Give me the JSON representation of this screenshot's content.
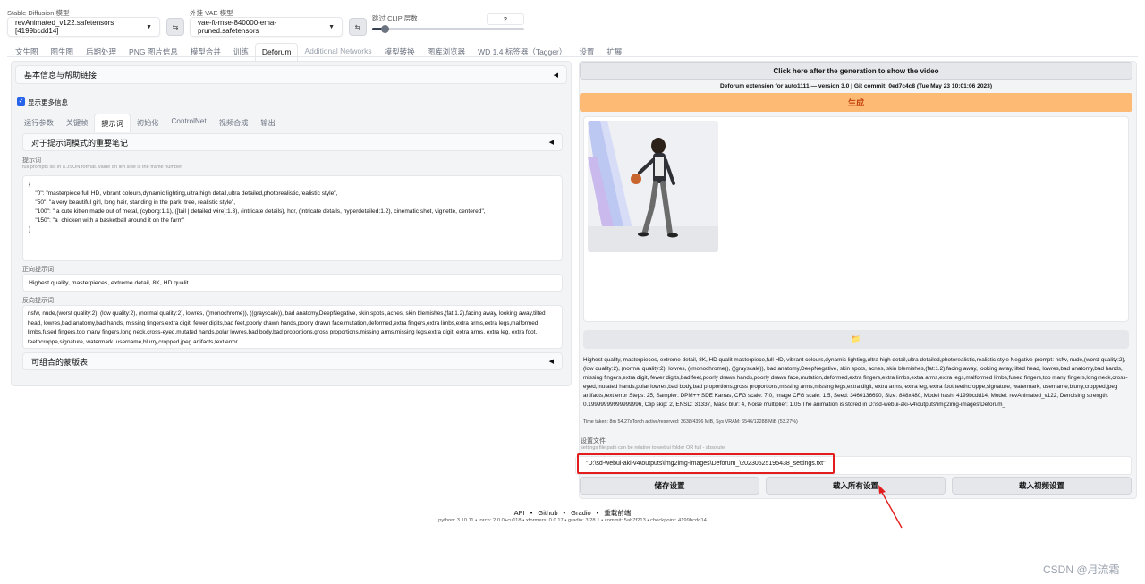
{
  "top": {
    "sd_model_label": "Stable Diffusion 模型",
    "sd_model_value": "revAnimated_v122.safetensors [4199bcdd14]",
    "vae_label": "外挂 VAE 模型",
    "vae_value": "vae-ft-mse-840000-ema-pruned.safetensors",
    "clip_label": "跳过 CLIP 层数",
    "clip_value": "2",
    "clip_fraction": 0.08
  },
  "tabs": [
    {
      "label": "文生图"
    },
    {
      "label": "图生图"
    },
    {
      "label": "后期处理"
    },
    {
      "label": "PNG 图片信息"
    },
    {
      "label": "模型合并"
    },
    {
      "label": "训练"
    },
    {
      "label": "Deforum"
    },
    {
      "label": "Additional Networks"
    },
    {
      "label": "模型转换"
    },
    {
      "label": "图库浏览器"
    },
    {
      "label": "WD 1.4 标签器（Tagger）"
    },
    {
      "label": "设置"
    },
    {
      "label": "扩展"
    }
  ],
  "left": {
    "info_accordion": "基本信息与帮助链接",
    "show_more_label": "显示更多信息",
    "subtabs": [
      "运行参数",
      "关键帧",
      "提示词",
      "初始化",
      "ControlNet",
      "视频合成",
      "输出"
    ],
    "notes_accordion": "对于提示词模式的重要笔记",
    "prompts_label": "提示词",
    "prompts_hint": "full prompts list in a JSON format.  value on left side is the frame number",
    "prompts_lines": [
      "{",
      "    \"0\": \"masterpiece,full HD, vibrant colours,dynamic lighting,ultra high detail,ultra detailed,photorealistic,realistic style\",",
      "    \"50\": \"a very beautiful girl, long hair, standing in the park, tree, realistic style\",",
      "    \"100\": \" a cute kitten made out of metal, (cyborg:1.1), ([tail | detailed wire]:1.3), (intricate details), hdr, (intricate details, hyperdetailed:1.2), cinematic shot, vignette, centered\",",
      "    \"150\": \"a  chicken with a basketball around it on the farm\"",
      "}"
    ],
    "positive_label": "正向提示词",
    "positive_value": "Highest quality, masterpieces, extreme detail, 8K, HD qualit",
    "negative_label": "反向提示词",
    "negative_value": "nsfw, nude,(worst quality:2), (low quality:2), (normal quality:2), lowres, ((monochrome)), ((grayscale)), bad anatomy,DeepNegative, skin spots, acnes, skin blemishes,(fat:1.2),facing away, looking away,tilted head, lowres,bad anatomy,bad hands, missing fingers,extra digit, fewer digits,bad feet,poorly drawn hands,poorly drawn face,mutation,deformed,extra fingers,extra limbs,extra arms,extra legs,malformed limbs,fused fingers,too many fingers,long neck,cross-eyed,mutated hands,polar lowres,bad body,bad proportions,gross proportions,missing arms,missing legs,extra digit, extra arms, extra leg, extra foot, teethcroppe,signature, watermark, username,blurry,cropped,jpeg artifacts,text,error",
    "mask_accordion": "可组合的蒙版表"
  },
  "right": {
    "show_video_button": "Click here after the generation to show the video",
    "version_text": "Deforum extension for auto1111 — version 3.0 | Git commit: 0ed7c4c8 (Tue May 23 10:01:06 2023)",
    "generate_button": "生成",
    "folder_icon": "📁",
    "info_text": "Highest quality, masterpieces, extreme detail, 8K, HD qualit masterpiece,full HD, vibrant colours,dynamic lighting,ultra high detail,ultra detailed,photorealistic,realistic style Negative prompt: nsfw, nude,(worst quality:2), (low quality:2), (normal quality:2), lowres, ((monochrome)), ((grayscale)), bad anatomy,DeepNegative, skin spots, acnes, skin blemishes,(fat:1.2),facing away, looking away,tilted head, lowres,bad anatomy,bad hands, missing fingers,extra digit, fewer digits,bad feet,poorly drawn hands,poorly drawn face,mutation,deformed,extra fingers,extra limbs,extra arms,extra legs,malformed limbs,fused fingers,too many fingers,long neck,cross-eyed,mutated hands,polar lowres,bad body,bad proportions,gross proportions,missing arms,missing legs,extra digit, extra arms, extra leg, extra foot,teethcroppe,signature, watermark, username,blurry,cropped,jpeg artifacts,text,error Steps: 25, Sampler: DPM++ SDE Karras, CFG scale: 7.0, Image CFG scale: 1.5, Seed: 3460136690, Size: 848x480, Model hash: 4199bcdd14, Model: revAnimated_v122, Denoising strength: 0.19999999999999996, Clip skip: 2, ENSD: 31337, Mask blur: 4, Noise multiplier: 1.05 The animation is stored in D:\\sd-webui-aki-v4\\outputs\\img2img-images\\Deforum_",
    "time_text": "Time taken: 8m 54.27sTorch active/reserved: 3638/4396 MiB, Sys VRAM: 6546/12288 MiB (53.27%)",
    "settings_label": "设置文件",
    "settings_hint": "settings file path can be relative to webui folder OR full - absolute",
    "settings_path": "\"D:\\sd-webui-aki-v4\\outputs\\img2img-images\\Deforum_\\20230525195438_settings.txt\"",
    "save_button": "储存设置",
    "load_all_button": "载入所有设置",
    "load_video_button": "载入视频设置"
  },
  "footer": {
    "links": [
      "API",
      "Github",
      "Gradio",
      "重载前端"
    ],
    "info": "python: 3.10.11  •  torch: 2.0.0+cu118  •  xformers: 0.0.17  •  gradio: 3.28.1  •  commit: 5ab7f213  •  checkpoint: 4199bcdd14"
  },
  "watermark": "CSDN @月流霜",
  "colors": {
    "generate": "#fdba74",
    "highlight": "#e11d1d",
    "accent": "#2563eb"
  }
}
